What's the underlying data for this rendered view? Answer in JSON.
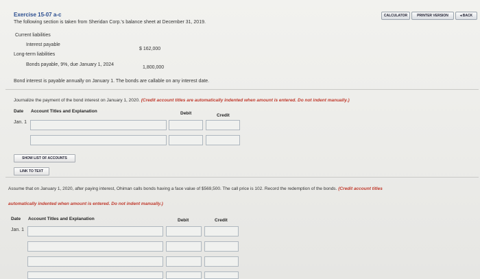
{
  "toolbar": {
    "calculator": "CALCULATOR",
    "printer": "PRINTER VERSION",
    "back": "◂ BACK"
  },
  "exercise": {
    "title": "Exercise 15-07 a-c",
    "intro": "The following section is taken from Sheridan Corp.'s balance sheet at December 31, 2019.",
    "current_liab": "Current liabilities",
    "interest_label": "Interest payable",
    "interest_value": "$  162,000",
    "lt_liab": "Long-term liabilities",
    "bonds_label": "Bonds payable, 9%, due January 1, 2024",
    "bonds_value": "1,800,000",
    "note": "Bond interest is payable annually on January 1. The bonds are callable on any interest date."
  },
  "part_a": {
    "instr_plain": "Journalize the payment of the bond interest on January 1, 2020.",
    "instr_red": "(Credit account titles are automatically indented when amount is entered. Do not indent manually.)",
    "col_date": "Date",
    "col_acct": "Account Titles and Explanation",
    "col_debit": "Debit",
    "col_credit": "Credit",
    "row_date": "Jan. 1",
    "show_accounts": "SHOW LIST OF ACCOUNTS",
    "link_text": "LINK TO TEXT"
  },
  "part_b": {
    "instr_plain": "Assume that on January 1, 2020, after paying interest, Ohiman calls bonds having a face value of $569,500. The call price is 102. Record the redemption of the bonds.",
    "instr_red_1": "(Credit account titles",
    "instr_red_2": "automatically indented when amount is entered. Do not indent manually.)",
    "col_date": "Date",
    "col_acct": "Account Titles and Explanation",
    "col_debit": "Debit",
    "col_credit": "Credit",
    "row_date": "Jan. 1"
  }
}
